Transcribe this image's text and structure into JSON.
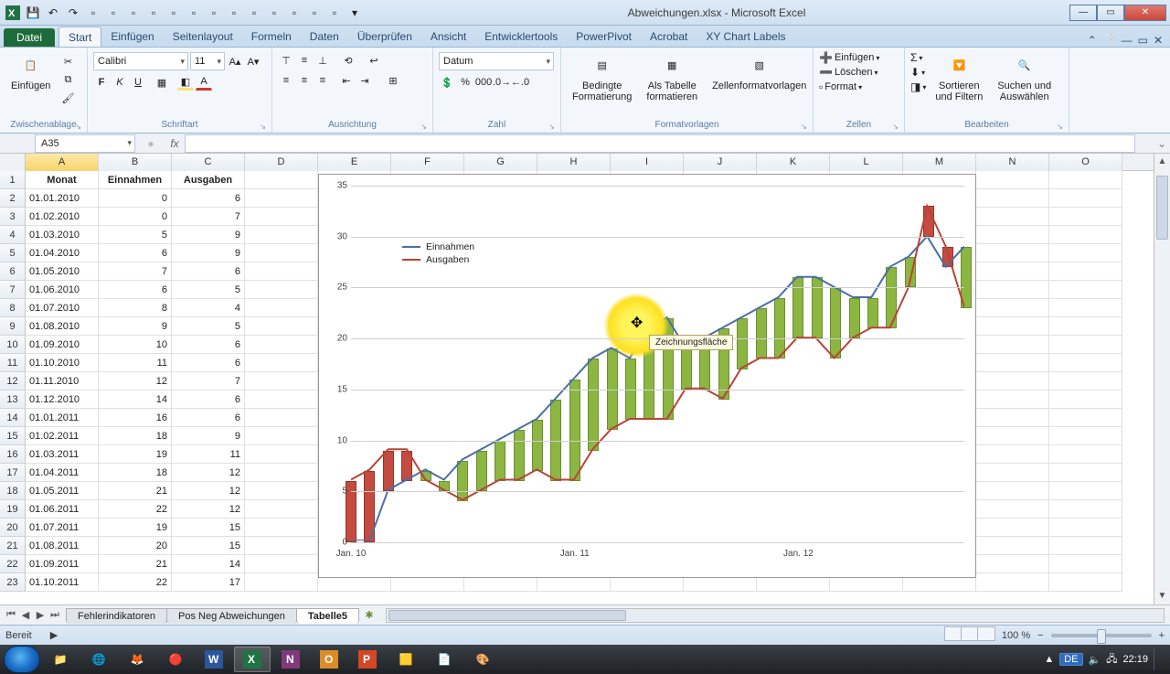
{
  "window": {
    "title": "Abweichungen.xlsx - Microsoft Excel"
  },
  "file_tab": "Datei",
  "tabs": [
    "Start",
    "Einfügen",
    "Seitenlayout",
    "Formeln",
    "Daten",
    "Überprüfen",
    "Ansicht",
    "Entwicklertools",
    "PowerPivot",
    "Acrobat",
    "XY Chart Labels"
  ],
  "active_tab_index": 0,
  "ribbon": {
    "clipboard": {
      "paste": "Einfügen",
      "label": "Zwischenablage"
    },
    "font": {
      "name": "Calibri",
      "size": "11",
      "label": "Schriftart"
    },
    "alignment": {
      "label": "Ausrichtung"
    },
    "number": {
      "format": "Datum",
      "label": "Zahl"
    },
    "styles": {
      "cond": "Bedingte\nFormatierung",
      "table": "Als Tabelle\nformatieren",
      "cell": "Zellenformatvorlagen",
      "label": "Formatvorlagen"
    },
    "cells": {
      "insert": "Einfügen",
      "delete": "Löschen",
      "format": "Format",
      "label": "Zellen"
    },
    "editing": {
      "sort": "Sortieren\nund Filtern",
      "find": "Suchen und\nAuswählen",
      "label": "Bearbeiten"
    }
  },
  "namebox": "A35",
  "fx": "fx",
  "columns": [
    "A",
    "B",
    "C",
    "D",
    "E",
    "F",
    "G",
    "H",
    "I",
    "J",
    "K",
    "L",
    "M",
    "N",
    "O"
  ],
  "headers": [
    "Monat",
    "Einnahmen",
    "Ausgaben"
  ],
  "rows": [
    [
      "01.01.2010",
      "0",
      "6"
    ],
    [
      "01.02.2010",
      "0",
      "7"
    ],
    [
      "01.03.2010",
      "5",
      "9"
    ],
    [
      "01.04.2010",
      "6",
      "9"
    ],
    [
      "01.05.2010",
      "7",
      "6"
    ],
    [
      "01.06.2010",
      "6",
      "5"
    ],
    [
      "01.07.2010",
      "8",
      "4"
    ],
    [
      "01.08.2010",
      "9",
      "5"
    ],
    [
      "01.09.2010",
      "10",
      "6"
    ],
    [
      "01.10.2010",
      "11",
      "6"
    ],
    [
      "01.11.2010",
      "12",
      "7"
    ],
    [
      "01.12.2010",
      "14",
      "6"
    ],
    [
      "01.01.2011",
      "16",
      "6"
    ],
    [
      "01.02.2011",
      "18",
      "9"
    ],
    [
      "01.03.2011",
      "19",
      "11"
    ],
    [
      "01.04.2011",
      "18",
      "12"
    ],
    [
      "01.05.2011",
      "21",
      "12"
    ],
    [
      "01.06.2011",
      "22",
      "12"
    ],
    [
      "01.07.2011",
      "19",
      "15"
    ],
    [
      "01.08.2011",
      "20",
      "15"
    ],
    [
      "01.09.2011",
      "21",
      "14"
    ],
    [
      "01.10.2011",
      "22",
      "17"
    ]
  ],
  "chart_data": {
    "type": "line",
    "title": "",
    "ylim": [
      0,
      35
    ],
    "yticks": [
      0,
      5,
      10,
      15,
      20,
      25,
      30,
      35
    ],
    "xticks": [
      "Jan. 10",
      "Jan. 11",
      "Jan. 12"
    ],
    "legend": [
      "Einnahmen",
      "Ausgaben"
    ],
    "legend_colors": [
      "#4a6fa5",
      "#b94337"
    ],
    "categories": [
      "01.01.2010",
      "01.02.2010",
      "01.03.2010",
      "01.04.2010",
      "01.05.2010",
      "01.06.2010",
      "01.07.2010",
      "01.08.2010",
      "01.09.2010",
      "01.10.2010",
      "01.11.2010",
      "01.12.2010",
      "01.01.2011",
      "01.02.2011",
      "01.03.2011",
      "01.04.2011",
      "01.05.2011",
      "01.06.2011",
      "01.07.2011",
      "01.08.2011",
      "01.09.2011",
      "01.10.2011",
      "01.11.2011",
      "01.12.2011",
      "01.01.2012",
      "01.02.2012",
      "01.03.2012",
      "01.04.2012",
      "01.05.2012",
      "01.06.2012",
      "01.07.2012",
      "01.08.2012",
      "01.09.2012",
      "01.10.2012"
    ],
    "series": [
      {
        "name": "Einnahmen",
        "values": [
          0,
          0,
          5,
          6,
          7,
          6,
          8,
          9,
          10,
          11,
          12,
          14,
          16,
          18,
          19,
          18,
          21,
          22,
          19,
          20,
          21,
          22,
          23,
          24,
          26,
          26,
          25,
          24,
          24,
          27,
          28,
          30,
          27,
          29
        ]
      },
      {
        "name": "Ausgaben",
        "values": [
          6,
          7,
          9,
          9,
          6,
          5,
          4,
          5,
          6,
          6,
          7,
          6,
          6,
          9,
          11,
          12,
          12,
          12,
          15,
          15,
          14,
          17,
          18,
          18,
          20,
          20,
          18,
          20,
          21,
          21,
          25,
          33,
          29,
          23
        ]
      }
    ],
    "tooltip": "Zeichnungsfläche"
  },
  "sheets": {
    "tabs": [
      "Fehlerindikatoren",
      "Pos Neg Abweichungen",
      "Tabelle5"
    ],
    "active": 2
  },
  "status": {
    "ready": "Bereit",
    "zoom": "100 %",
    "lang": "DE",
    "time": "22:19"
  },
  "taskbar_icons": [
    "folder",
    "ie",
    "firefox",
    "chrome",
    "word",
    "excel",
    "onenote",
    "outlook",
    "powerpoint",
    "snagit",
    "editor",
    "paint"
  ]
}
